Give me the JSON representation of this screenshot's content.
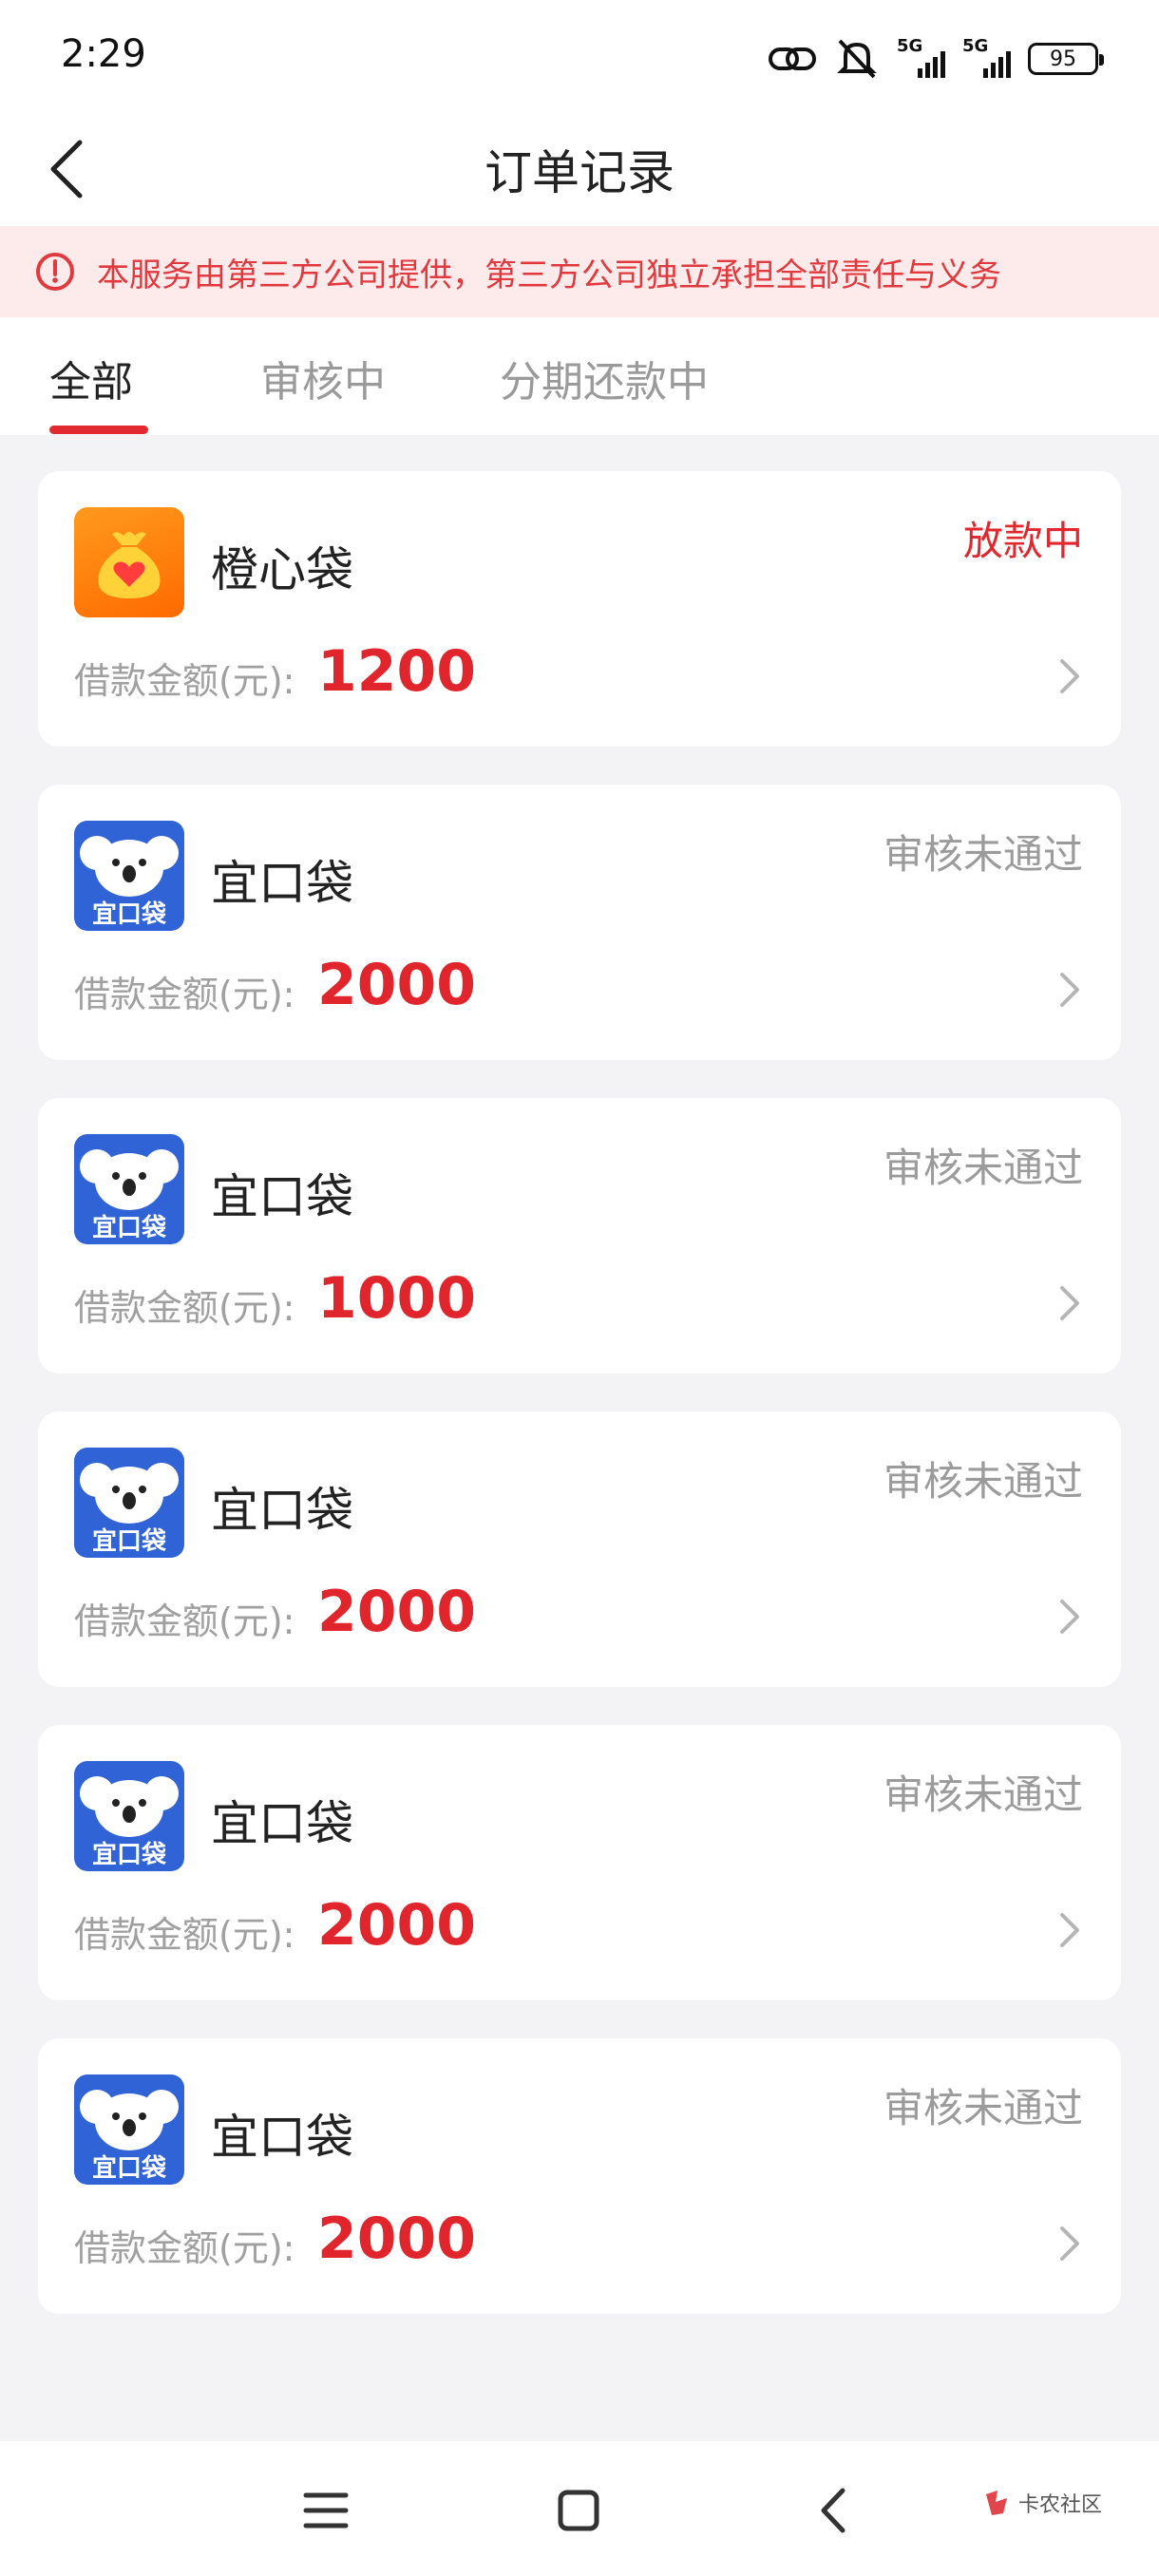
{
  "status_bar": {
    "time": "2:29",
    "battery": "95",
    "network_1": "5G",
    "network_2": "5G"
  },
  "header": {
    "title": "订单记录"
  },
  "notice": {
    "text": "本服务由第三方公司提供，第三方公司独立承担全部责任与义务"
  },
  "tabs": [
    {
      "label": "全部",
      "active": true
    },
    {
      "label": "审核中",
      "active": false
    },
    {
      "label": "分期还款中",
      "active": false
    }
  ],
  "orders": [
    {
      "name": "橙心袋",
      "status": "放款中",
      "amount_label": "借款金额(元):",
      "amount": "1200",
      "logo": "orange-heart-bag"
    },
    {
      "name": "宜口袋",
      "status": "审核未通过",
      "amount_label": "借款金额(元):",
      "amount": "2000",
      "logo": "koala",
      "logo_text": "宜口袋"
    },
    {
      "name": "宜口袋",
      "status": "审核未通过",
      "amount_label": "借款金额(元):",
      "amount": "1000",
      "logo": "koala",
      "logo_text": "宜口袋"
    },
    {
      "name": "宜口袋",
      "status": "审核未通过",
      "amount_label": "借款金额(元):",
      "amount": "2000",
      "logo": "koala",
      "logo_text": "宜口袋"
    },
    {
      "name": "宜口袋",
      "status": "审核未通过",
      "amount_label": "借款金额(元):",
      "amount": "2000",
      "logo": "koala",
      "logo_text": "宜口袋"
    },
    {
      "name": "宜口袋",
      "status": "审核未通过",
      "amount_label": "借款金额(元):",
      "amount": "2000",
      "logo": "koala",
      "logo_text": "宜口袋"
    }
  ],
  "watermark": {
    "text": "卡农社区"
  },
  "colors": {
    "accent_red": "#e0282e",
    "notice_bg": "#fdebec",
    "page_bg": "#f3f3f5"
  }
}
